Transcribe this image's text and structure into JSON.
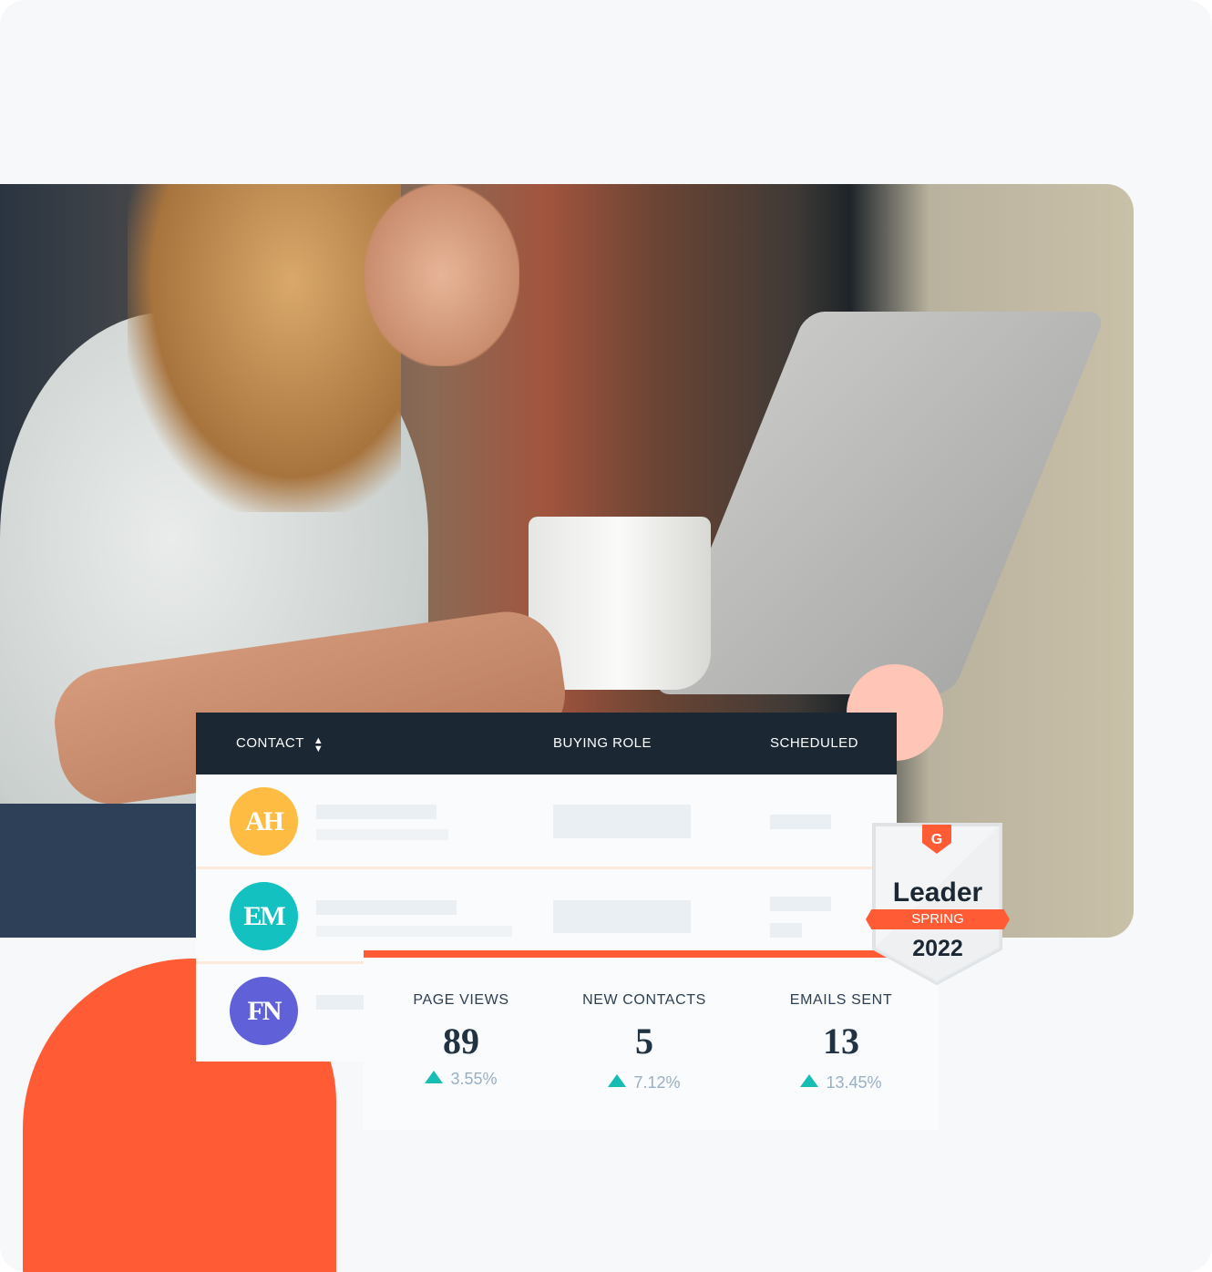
{
  "table": {
    "columns": [
      "CONTACT",
      "BUYING ROLE",
      "SCHEDULED"
    ],
    "sort_icon": "sort-up-down-icon",
    "rows": [
      {
        "initials": "AH",
        "color": "#ffbc42"
      },
      {
        "initials": "EM",
        "color": "#13c1c1"
      },
      {
        "initials": "FN",
        "color": "#6060d8"
      }
    ]
  },
  "stats": [
    {
      "label": "PAGE VIEWS",
      "value": "89",
      "change": "3.55%",
      "trend": "up"
    },
    {
      "label": "NEW CONTACTS",
      "value": "5",
      "change": "7.12%",
      "trend": "up"
    },
    {
      "label": "EMAILS SENT",
      "value": "13",
      "change": "13.45%",
      "trend": "up"
    }
  ],
  "badge": {
    "brand": "G2",
    "title": "Leader",
    "season": "SPRING",
    "year": "2022"
  },
  "colors": {
    "accent": "#ff5c35",
    "header": "#1b2733",
    "trend_up": "#16bdb3",
    "pink": "#ffc6b8"
  }
}
